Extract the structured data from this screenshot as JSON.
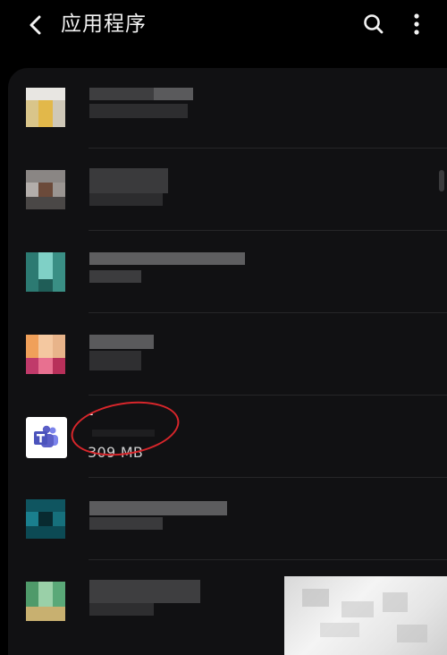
{
  "header": {
    "title": "应用程序",
    "back_icon": "chevron-left-icon",
    "search_icon": "search-icon",
    "more_icon": "more-vertical-icon"
  },
  "apps": [
    {
      "id": "app-1",
      "name": "",
      "size": "",
      "obscured": true
    },
    {
      "id": "app-2",
      "name": "",
      "size": "",
      "obscured": true
    },
    {
      "id": "app-3",
      "name": "",
      "size": "",
      "obscured": true
    },
    {
      "id": "app-4",
      "name": "",
      "size": "",
      "obscured": true
    },
    {
      "id": "teams",
      "name": "-",
      "size": "309 MB",
      "icon": "teams-icon",
      "highlighted": true
    },
    {
      "id": "app-6",
      "name": "",
      "size": "",
      "obscured": true
    },
    {
      "id": "app-7",
      "name": "",
      "size": "",
      "obscured": true
    }
  ],
  "colors": {
    "background": "#000000",
    "card": "#111113",
    "annotation_circle": "#d8262b",
    "teams_purple": "#5b5fc7"
  }
}
